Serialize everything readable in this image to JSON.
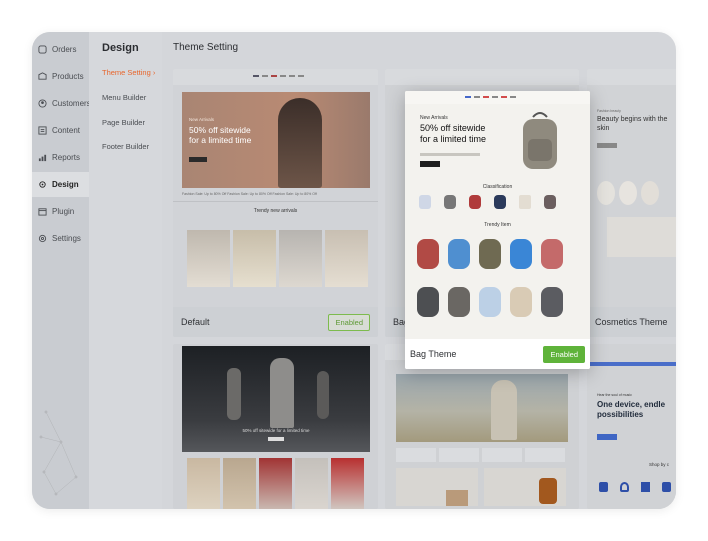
{
  "sidebar_primary": {
    "items": [
      {
        "label": "Orders",
        "icon": "orders-icon",
        "active": false
      },
      {
        "label": "Products",
        "icon": "products-icon",
        "active": false
      },
      {
        "label": "Customers",
        "icon": "customers-icon",
        "active": false
      },
      {
        "label": "Content",
        "icon": "content-icon",
        "active": false
      },
      {
        "label": "Reports",
        "icon": "reports-icon",
        "active": false
      },
      {
        "label": "Design",
        "icon": "design-icon",
        "active": true
      },
      {
        "label": "Plugin",
        "icon": "plugin-icon",
        "active": false
      },
      {
        "label": "Settings",
        "icon": "settings-icon",
        "active": false
      }
    ]
  },
  "sidebar_secondary": {
    "title": "Design",
    "items": [
      {
        "label": "Theme Setting",
        "active": true
      },
      {
        "label": "Menu Builder",
        "active": false
      },
      {
        "label": "Page Builder",
        "active": false
      },
      {
        "label": "Footer Builder",
        "active": false
      }
    ]
  },
  "main": {
    "title": "Theme Setting"
  },
  "themes": {
    "default": {
      "name": "Default",
      "button": "Enabled",
      "hero_small": "New Arrivals",
      "hero_line1": "50% off sitewide",
      "hero_line2": "for a limited time",
      "ticker": "Fashion Sale: Up to 80% Off   Fashion Sale: Up to 80% Off   Fashion Sale: Up to 80% Off",
      "section": "Trendy new arrivals"
    },
    "bag": {
      "name": "Bag Theme",
      "button": "Enabled",
      "hero_small": "New Arrivals",
      "hero_line1": "50% off sitewide",
      "hero_line2": "for a limited time",
      "section1": "Classification",
      "section2": "Trendy Item"
    },
    "cosmetics": {
      "name": "Cosmetics Theme",
      "hero_small": "Fashion beauty",
      "hero_line1": "Beauty begins with the",
      "hero_line2": "skin"
    },
    "dark_fashion": {
      "hero_line": "50% off sitewide for a limited time"
    },
    "music": {
      "hero_small": "Hear the soul of music",
      "hero_line1": "One device, endle",
      "hero_line2": "possibilities",
      "section": "Shop by c"
    }
  },
  "colors": {
    "accent": "#e8662d",
    "enabled_green": "#5fb33a"
  }
}
